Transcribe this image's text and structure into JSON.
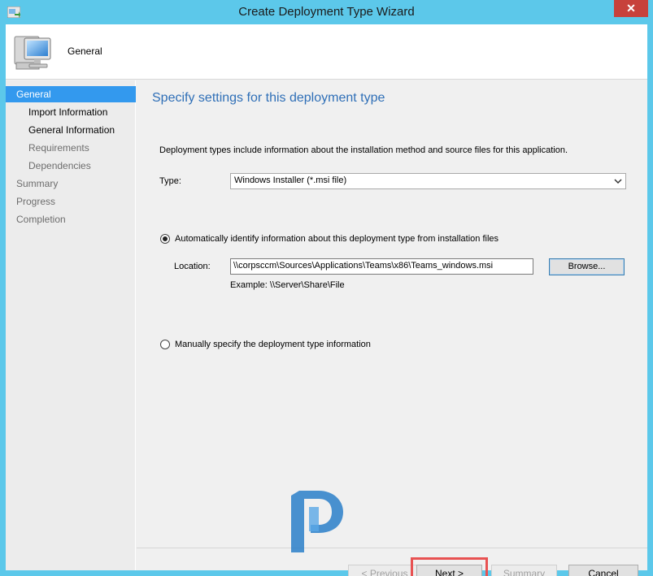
{
  "window": {
    "title": "Create Deployment Type Wizard",
    "close_glyph": "✕"
  },
  "header": {
    "title": "General"
  },
  "nav": {
    "items": [
      {
        "label": "General"
      },
      {
        "label": "Import Information"
      },
      {
        "label": "General Information"
      },
      {
        "label": "Requirements"
      },
      {
        "label": "Dependencies"
      },
      {
        "label": "Summary"
      },
      {
        "label": "Progress"
      },
      {
        "label": "Completion"
      }
    ]
  },
  "main": {
    "heading": "Specify settings for this deployment type",
    "description": "Deployment types include information about the installation method and source files for this application.",
    "type_label": "Type:",
    "type_value": "Windows Installer (*.msi file)",
    "auto_option_label": "Automatically identify information about this deployment type from installation files",
    "location_label": "Location:",
    "location_value": "\\\\corpsccm\\Sources\\Applications\\Teams\\x86\\Teams_windows.msi",
    "browse_label": "Browse...",
    "example_text": "Example:  \\\\Server\\Share\\File",
    "manual_option_label": "Manually specify the deployment type information"
  },
  "footer": {
    "previous_label": "< Previous",
    "next_label": "Next >",
    "summary_label": "Summary",
    "cancel_label": "Cancel"
  },
  "colors": {
    "titlebar": "#5cc8ea",
    "accent": "#3399ee",
    "heading": "#2f6fb7",
    "highlight": "#e85252"
  }
}
